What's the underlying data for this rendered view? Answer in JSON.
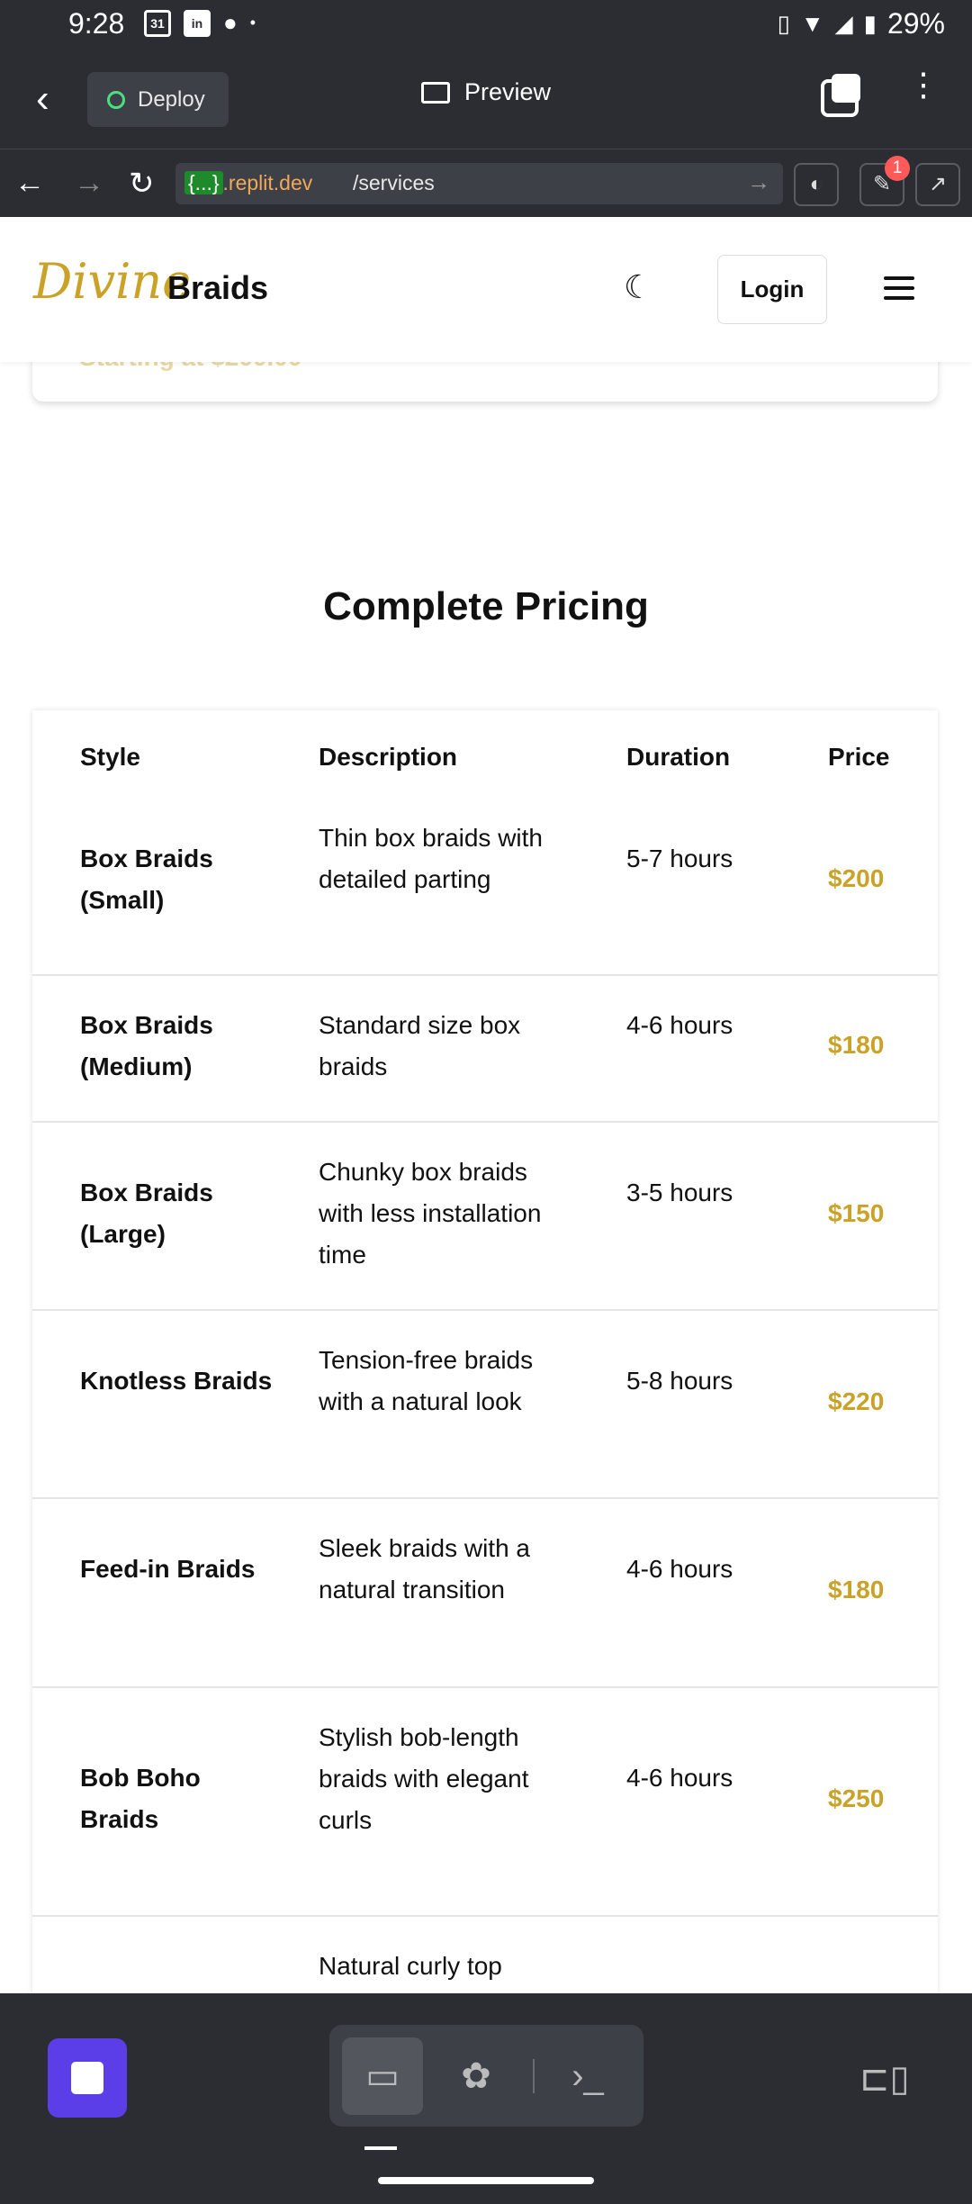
{
  "status_bar": {
    "time": "9:28",
    "battery": "29%"
  },
  "replit": {
    "deploy_label": "Deploy",
    "preview_label": "Preview",
    "url_host_brace": "{...}",
    "url_host": ".replit.dev",
    "url_path": "/services",
    "notification_count": "1"
  },
  "site": {
    "logo_script": "Divine",
    "logo_word": "Braids",
    "login_label": "Login",
    "prev_card_text": "Starting at $200.00"
  },
  "pricing": {
    "title": "Complete Pricing",
    "headers": {
      "style": "Style",
      "description": "Description",
      "duration": "Duration",
      "price": "Price"
    },
    "rows": [
      {
        "style": "Box Braids (Small)",
        "description": "Thin box braids with detailed parting",
        "duration": "5-7 hours",
        "price": "$200"
      },
      {
        "style": "Box Braids (Medium)",
        "description": "Standard size box braids",
        "duration": "4-6 hours",
        "price": "$180"
      },
      {
        "style": "Box Braids (Large)",
        "description": "Chunky box braids with less installation time",
        "duration": "3-5 hours",
        "price": "$150"
      },
      {
        "style": "Knotless Braids",
        "description": "Tension-free braids with a natural look",
        "duration": "5-8 hours",
        "price": "$220"
      },
      {
        "style": "Feed-in Braids",
        "description": "Sleek braids with a natural transition",
        "duration": "4-6 hours",
        "price": "$180"
      },
      {
        "style": "Bob Boho Braids",
        "description": "Stylish bob-length braids with elegant curls",
        "duration": "4-6 hours",
        "price": "$250"
      },
      {
        "style": "",
        "description": "Natural curly top",
        "duration": "",
        "price": ""
      }
    ]
  },
  "colors": {
    "accent_gold": "#c9a227",
    "stop_button": "#5b3ee8",
    "chrome_dark": "#2b2d33"
  }
}
